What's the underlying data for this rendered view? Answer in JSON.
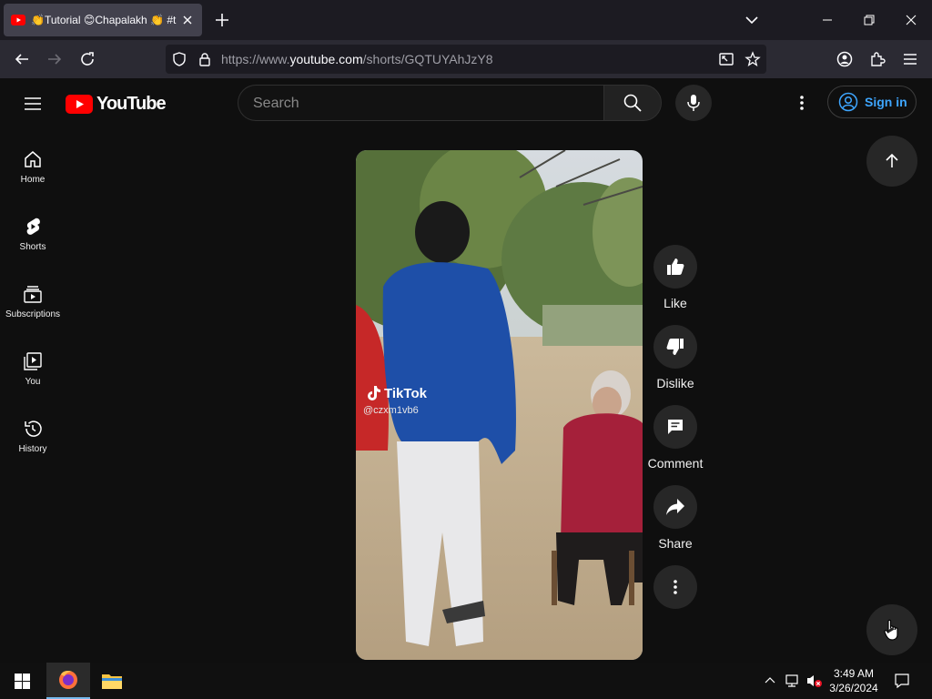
{
  "browser": {
    "tab_title": "👏Tutorial 😊Chapalakh 👏 #t",
    "url_prefix": "https://www.",
    "url_host": "youtube.com",
    "url_path": "/shorts/GQTUYAhJzY8"
  },
  "youtube": {
    "logo_text": "YouTube",
    "search_placeholder": "Search",
    "sign_in_label": "Sign in"
  },
  "sidebar": {
    "items": [
      {
        "label": "Home",
        "icon": "home-icon"
      },
      {
        "label": "Shorts",
        "icon": "shorts-icon"
      },
      {
        "label": "Subscriptions",
        "icon": "subscriptions-icon"
      },
      {
        "label": "You",
        "icon": "you-icon"
      },
      {
        "label": "History",
        "icon": "history-icon"
      }
    ]
  },
  "video": {
    "watermark_brand": "TikTok",
    "watermark_handle": "@czxm1vb6"
  },
  "actions": {
    "like": "Like",
    "dislike": "Dislike",
    "comment": "Comment",
    "share": "Share"
  },
  "taskbar": {
    "time": "3:49 AM",
    "date": "3/26/2024"
  },
  "colors": {
    "youtube_red": "#ff0000",
    "link_blue": "#3ea6ff",
    "background": "#0f0f0f"
  }
}
